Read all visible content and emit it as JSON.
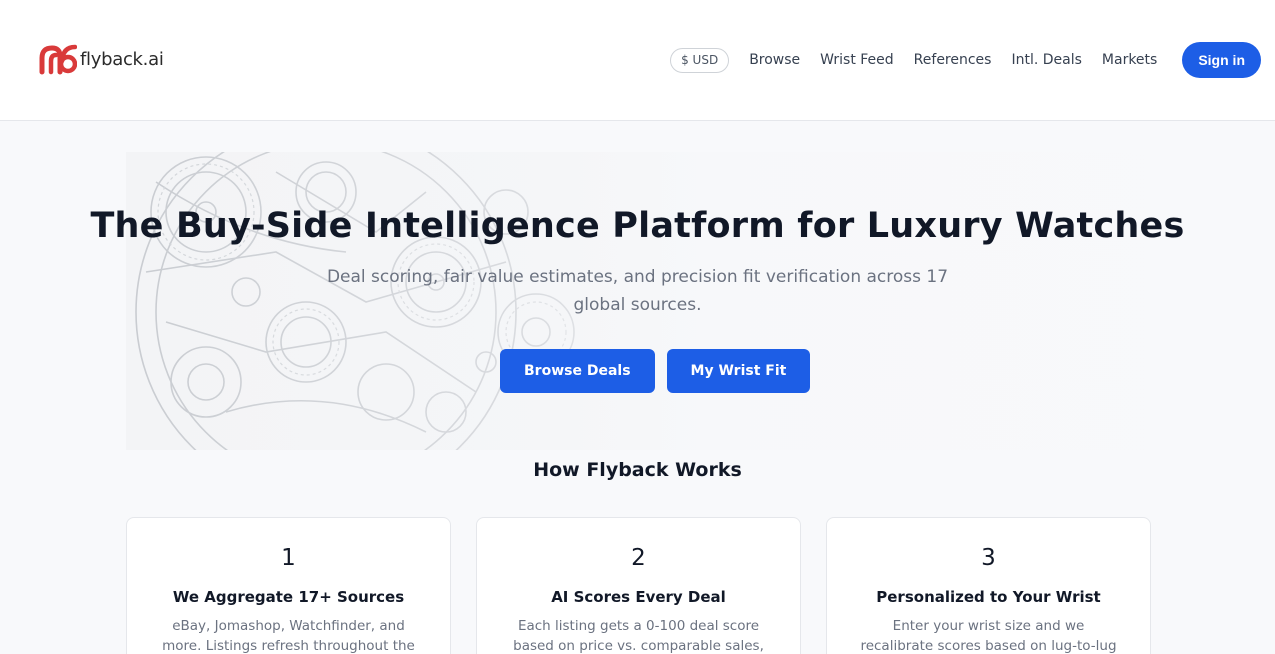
{
  "brand": {
    "name": "flyback.ai",
    "accent": "#d93a3a",
    "primary": "#1d5ee6"
  },
  "header": {
    "currency": "$ USD",
    "nav": [
      "Browse",
      "Wrist Feed",
      "References",
      "Intl. Deals",
      "Markets"
    ],
    "signin": "Sign in"
  },
  "hero": {
    "title": "The Buy-Side Intelligence Platform for Luxury Watches",
    "subtitle": "Deal scoring, fair value estimates, and precision fit verification across 17 global sources.",
    "primary_button": "Browse Deals",
    "secondary_button": "My Wrist Fit",
    "background_icon": "watch-movement-illustration"
  },
  "how": {
    "title": "How Flyback Works",
    "steps": [
      {
        "num": "1",
        "title": "We Aggregate 17+ Sources",
        "text": "eBay, Jomashop, Watchfinder, and more. Listings refresh throughout the day with"
      },
      {
        "num": "2",
        "title": "AI Scores Every Deal",
        "text": "Each listing gets a 0-100 deal score based on price vs. comparable sales, seller"
      },
      {
        "num": "3",
        "title": "Personalized to Your Wrist",
        "text": "Enter your wrist size and we recalibrate scores based on lug-to-lug fit. No more"
      }
    ]
  }
}
